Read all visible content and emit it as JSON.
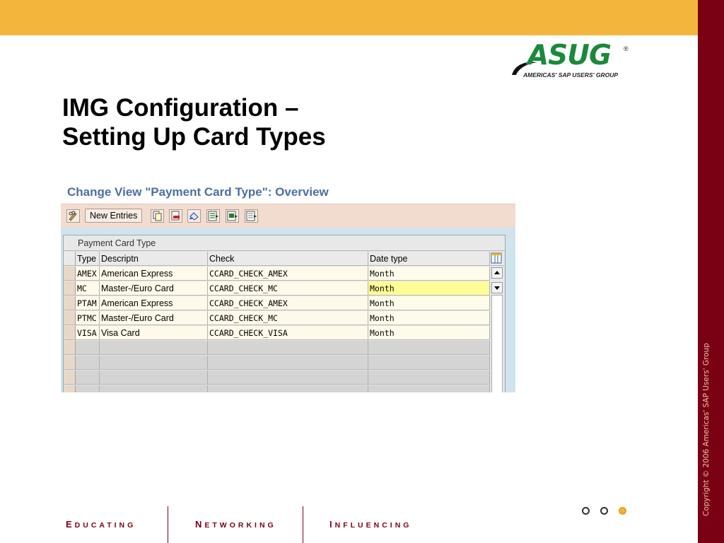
{
  "branding": {
    "logo_word": "ASUG",
    "logo_registered": "®",
    "logo_tagline": "AMERICAS' SAP USERS' GROUP",
    "copyright": "Copyright © 2006 Americas' SAP Users' Group",
    "accent_colors": {
      "top_bar": "#f2b63c",
      "side_bar": "#7a0014",
      "logo_green": "#1a8a3a"
    }
  },
  "slide": {
    "title_line1": "IMG Configuration –",
    "title_line2": "Setting Up Card Types"
  },
  "sap_screen": {
    "title": "Change View \"Payment Card Type\": Overview",
    "toolbar": {
      "new_entries_label": "New Entries",
      "icons": [
        "pencil-glasses-icon",
        "copy-icon",
        "delete-icon",
        "undo-icon",
        "select-all-icon",
        "select-block-icon",
        "deselect-all-icon"
      ]
    },
    "table": {
      "caption": "Payment Card Type",
      "headers": {
        "type": "Type",
        "description": "Descriptn",
        "check": "Check",
        "date_type": "Date type"
      },
      "rows": [
        {
          "type": "AMEX",
          "description": "American Express",
          "check": "CCARD_CHECK_AMEX",
          "date_type": "Month"
        },
        {
          "type": "MC",
          "description": "Master-/Euro Card",
          "check": "CCARD_CHECK_MC",
          "date_type": "Month"
        },
        {
          "type": "PTAM",
          "description": "American Express",
          "check": "CCARD_CHECK_AMEX",
          "date_type": "Month"
        },
        {
          "type": "PTMC",
          "description": "Master-/Euro Card",
          "check": "CCARD_CHECK_MC",
          "date_type": "Month"
        },
        {
          "type": "VISA",
          "description": "Visa Card",
          "check": "CCARD_CHECK_VISA",
          "date_type": "Month"
        }
      ],
      "highlighted_cell": "row 2 Date type"
    }
  },
  "footer": {
    "educating_first": "E",
    "educating_rest": "DUCATING",
    "networking_first": "N",
    "networking_rest": "ETWORKING",
    "influencing_first": "I",
    "influencing_rest": "NFLUENCING"
  }
}
